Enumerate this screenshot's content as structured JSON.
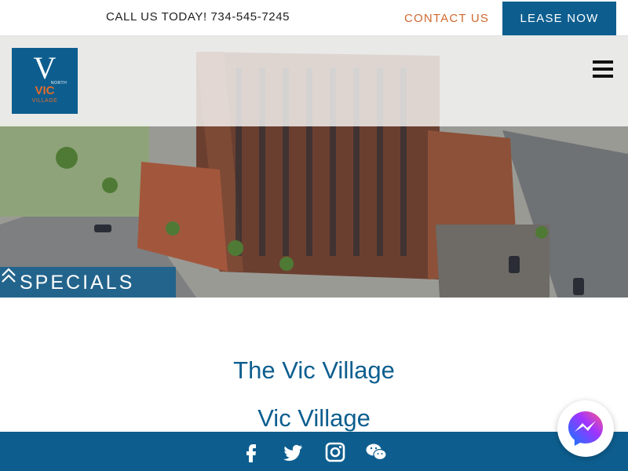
{
  "topbar": {
    "call": "CALL US TODAY! 734-545-7245",
    "contact": "CONTACT US",
    "lease": "LEASE NOW"
  },
  "logo": {
    "mark": "V",
    "north": "NORTH",
    "name": "VIC",
    "sub": "VILLAGE"
  },
  "hero": {
    "specials_label": "SPECIALS",
    "specials_icon": "double-chevron-up-icon"
  },
  "content": {
    "heading": "The Vic Village",
    "subheading": "Vic Village"
  },
  "social": [
    "facebook-icon",
    "twitter-icon",
    "instagram-icon",
    "wechat-icon",
    "messenger-icon"
  ],
  "colors": {
    "brand_blue": "#0d5e8f",
    "accent_orange": "#d0692f",
    "text_dark": "#222222"
  }
}
